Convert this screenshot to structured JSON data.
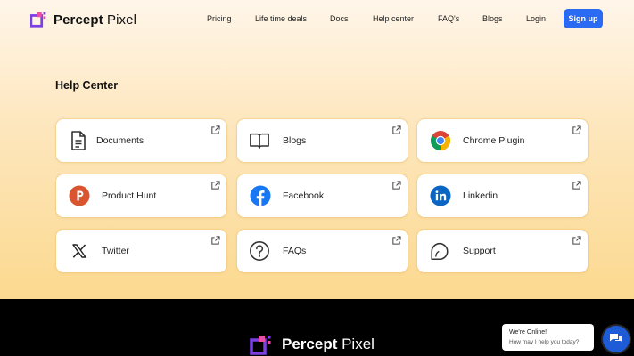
{
  "header": {
    "logo_bold": "Percept",
    "logo_light": " Pixel",
    "nav": [
      "Pricing",
      "Life time deals",
      "Docs",
      "Help center",
      "FAQ's",
      "Blogs",
      "Login"
    ],
    "signup_label": "Sign up"
  },
  "main": {
    "section_title": "Help Center",
    "cards": [
      {
        "label": "Documents",
        "icon": "document-icon"
      },
      {
        "label": "Blogs",
        "icon": "book-icon"
      },
      {
        "label": "Chrome Plugin",
        "icon": "chrome-icon"
      },
      {
        "label": "Product Hunt",
        "icon": "product-hunt-icon"
      },
      {
        "label": "Facebook",
        "icon": "facebook-icon"
      },
      {
        "label": "Linkedin",
        "icon": "linkedin-icon"
      },
      {
        "label": "Twitter",
        "icon": "x-icon"
      },
      {
        "label": "FAQs",
        "icon": "question-icon"
      },
      {
        "label": "Support",
        "icon": "chat-icon"
      }
    ]
  },
  "footer": {
    "logo_bold": "Percept",
    "logo_light": " Pixel"
  },
  "chat": {
    "status": "We're Online!",
    "prompt": "How may I help you today?"
  },
  "colors": {
    "accent": "#2b6bf3",
    "logo_purple": "#7b3fe4",
    "logo_pink": "#e94fa8",
    "product_hunt": "#da552f",
    "facebook": "#1877f2",
    "linkedin": "#0a66c2"
  }
}
